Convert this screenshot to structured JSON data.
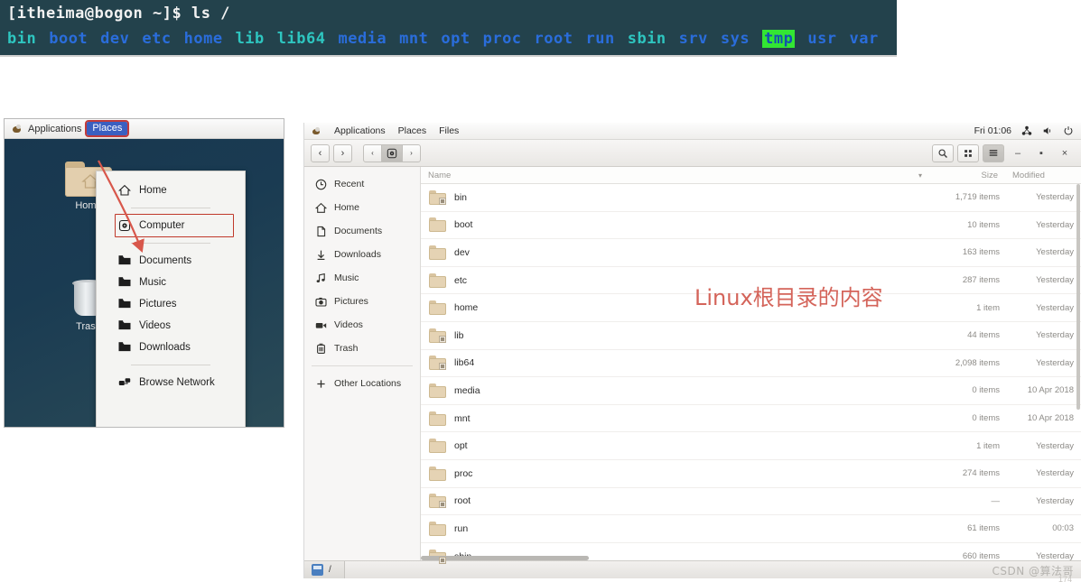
{
  "terminal": {
    "prompt": "[itheima@bogon ~]$ ls /",
    "entries": [
      {
        "name": "bin",
        "style": "cyan"
      },
      {
        "name": "boot",
        "style": "blue"
      },
      {
        "name": "dev",
        "style": "blue"
      },
      {
        "name": "etc",
        "style": "blue"
      },
      {
        "name": "home",
        "style": "blue"
      },
      {
        "name": "lib",
        "style": "cyan"
      },
      {
        "name": "lib64",
        "style": "cyan"
      },
      {
        "name": "media",
        "style": "blue"
      },
      {
        "name": "mnt",
        "style": "blue"
      },
      {
        "name": "opt",
        "style": "blue"
      },
      {
        "name": "proc",
        "style": "blue"
      },
      {
        "name": "root",
        "style": "blue"
      },
      {
        "name": "run",
        "style": "blue"
      },
      {
        "name": "sbin",
        "style": "cyan"
      },
      {
        "name": "srv",
        "style": "blue"
      },
      {
        "name": "sys",
        "style": "blue"
      },
      {
        "name": "tmp",
        "style": "tmp"
      },
      {
        "name": "usr",
        "style": "blue"
      },
      {
        "name": "var",
        "style": "blue"
      }
    ],
    "colors": {
      "background": "#23424c",
      "blue": "#2a6ddb",
      "cyan": "#2ec6c0",
      "tmp_bg": "#33e633"
    }
  },
  "desktop": {
    "topbar": {
      "applications": "Applications",
      "places": "Places"
    },
    "icons": [
      {
        "label": "Home",
        "icon": "home-folder-icon"
      },
      {
        "label": "Trash",
        "icon": "trash-icon"
      }
    ],
    "places_menu": {
      "items": [
        {
          "label": "Home",
          "icon": "home-icon"
        },
        {
          "label": "separator",
          "icon": "separator"
        },
        {
          "label": "Computer",
          "icon": "computer-icon",
          "highlighted": true
        },
        {
          "label": "separator",
          "icon": "separator"
        },
        {
          "label": "Documents",
          "icon": "folder-icon"
        },
        {
          "label": "Music",
          "icon": "folder-icon"
        },
        {
          "label": "Pictures",
          "icon": "folder-icon"
        },
        {
          "label": "Videos",
          "icon": "folder-icon"
        },
        {
          "label": "Downloads",
          "icon": "folder-icon"
        },
        {
          "label": "separator",
          "icon": "separator"
        },
        {
          "label": "Browse Network",
          "icon": "network-icon"
        }
      ],
      "highlight_color": "#c0392b"
    }
  },
  "files_window": {
    "topbar": {
      "applications": "Applications",
      "places": "Places",
      "files": "Files",
      "clock": "Fri 01:06",
      "indicators": [
        "network-icon",
        "volume-icon",
        "power-icon"
      ]
    },
    "toolbar": {
      "back": "‹",
      "forward": "›",
      "crumb_left": "‹",
      "crumb_current": "computer-icon",
      "crumb_right": "›",
      "search": "search-icon",
      "grid_view": "grid-view-icon",
      "list_view": "list-view-icon",
      "minimize": "–",
      "maximize": "▪",
      "close": "×"
    },
    "sidebar": [
      {
        "label": "Recent",
        "icon": "clock-icon"
      },
      {
        "label": "Home",
        "icon": "home-icon"
      },
      {
        "label": "Documents",
        "icon": "document-icon"
      },
      {
        "label": "Downloads",
        "icon": "download-icon"
      },
      {
        "label": "Music",
        "icon": "music-icon"
      },
      {
        "label": "Pictures",
        "icon": "camera-icon"
      },
      {
        "label": "Videos",
        "icon": "video-icon"
      },
      {
        "label": "Trash",
        "icon": "trash-icon"
      },
      {
        "label": "separator",
        "icon": "separator"
      },
      {
        "label": "Other Locations",
        "icon": "plus-icon"
      }
    ],
    "columns": {
      "name": "Name",
      "size": "Size",
      "modified": "Modified",
      "sort_indicator": "▾"
    },
    "rows": [
      {
        "name": "bin",
        "size": "1,719 items",
        "modified": "Yesterday",
        "symlink": true
      },
      {
        "name": "boot",
        "size": "10 items",
        "modified": "Yesterday",
        "symlink": false
      },
      {
        "name": "dev",
        "size": "163 items",
        "modified": "Yesterday",
        "symlink": false
      },
      {
        "name": "etc",
        "size": "287 items",
        "modified": "Yesterday",
        "symlink": false
      },
      {
        "name": "home",
        "size": "1 item",
        "modified": "Yesterday",
        "symlink": false
      },
      {
        "name": "lib",
        "size": "44 items",
        "modified": "Yesterday",
        "symlink": true
      },
      {
        "name": "lib64",
        "size": "2,098 items",
        "modified": "Yesterday",
        "symlink": true
      },
      {
        "name": "media",
        "size": "0 items",
        "modified": "10 Apr 2018",
        "symlink": false
      },
      {
        "name": "mnt",
        "size": "0 items",
        "modified": "10 Apr 2018",
        "symlink": false
      },
      {
        "name": "opt",
        "size": "1 item",
        "modified": "Yesterday",
        "symlink": false
      },
      {
        "name": "proc",
        "size": "274 items",
        "modified": "Yesterday",
        "symlink": false
      },
      {
        "name": "root",
        "size": "—",
        "modified": "Yesterday",
        "symlink": true
      },
      {
        "name": "run",
        "size": "61 items",
        "modified": "00:03",
        "symlink": false
      },
      {
        "name": "sbin",
        "size": "660 items",
        "modified": "Yesterday",
        "symlink": true
      }
    ],
    "statusbar": {
      "path": "/",
      "path_icon": "drive-icon"
    }
  },
  "annotation": {
    "text": "Linux根目录的内容",
    "color": "#d4645a"
  },
  "watermark": {
    "text": "CSDN @算法哥",
    "page": "174"
  }
}
